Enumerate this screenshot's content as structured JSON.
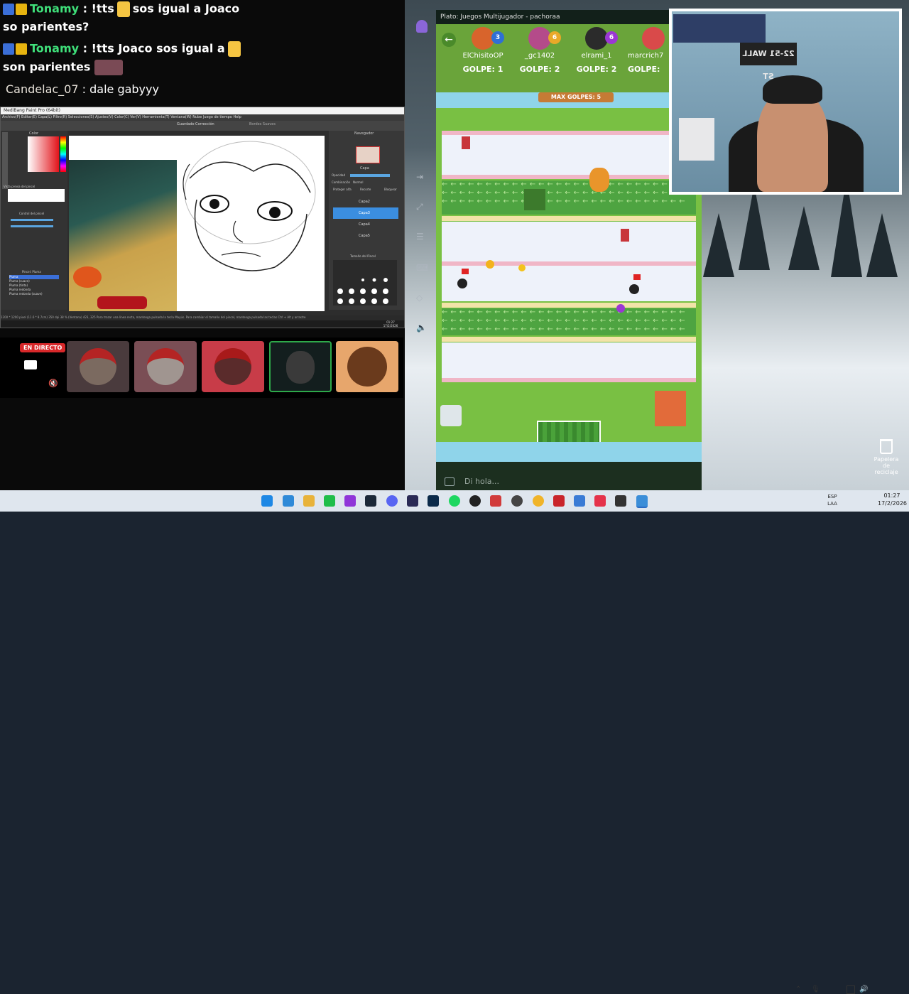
{
  "chat": {
    "messages": [
      {
        "user": "Tonamy",
        "text_before": ": !tts",
        "text_after": "sos igual a Joaco",
        "line2": "so parientes?"
      },
      {
        "user": "Tonamy",
        "text_before": ": !tts Joaco sos igual a",
        "line2": "son parientes"
      },
      {
        "user": "Candelac_07",
        "text": ": dale gabyyy"
      }
    ]
  },
  "paint": {
    "window_title": "MediBang Paint Pro (64bit)",
    "menu": "Archivo(F)   Editar(E)   Capa(L)   Filtro(R)   Selecciones(S)   Ajustes(V)   Color(C)   Ver(V)   Herramienta(T)   Ventana(W)   Nube   Juego de tiempo   Help",
    "saved_label": "Guardado",
    "correction_label": "Corrección",
    "border_label": "Bordes Suaves",
    "panels": {
      "color": "Color",
      "brush_preview": "Vista previa del pincel",
      "brush_control": "Control del pincel",
      "brush": "Pincel: Pluma",
      "navigator": "Navegador",
      "layer": "Capa",
      "opacity": "Opacidad",
      "blend": "Combinación",
      "blend_value": "Normal",
      "protect_alpha": "Proteger alfa",
      "clipping": "Recorte",
      "lock": "Bloquear",
      "brush_size": "Tamaño del Pincel"
    },
    "layers": [
      "Capa2",
      "Capa3",
      "Capa4",
      "Capa5"
    ],
    "brushes": [
      "Pluma",
      "Pluma (suave)",
      "Pluma (tinta)",
      "Pluma redonda",
      "Pluma redonda (suave)"
    ],
    "status": "1200 * 1200 pixel  (11.6 * 8.7cm)  350 dpi  38 %   (Ventana) 423, 325   Para trazar una línea recta, mantenga pulsada la tecla Mayús. Para cambiar el tamaño del pincel, mantenga pulsada las teclas Ctrl + Alt y arrastre",
    "time": "01:27",
    "date": "17/2/2026"
  },
  "call": {
    "live_label": "EN DIRECTO"
  },
  "game": {
    "window_title": "Plato: Juegos Multijugador - pachoraa",
    "max_label": "MAX GOLPES: 5",
    "chat_placeholder": "Di hola...",
    "players": [
      {
        "name": "ElChisitoOP",
        "badge": "3",
        "score": "GOLPE: 1",
        "badge_color": "#2f6fd6",
        "avatar_color": "#d8642c"
      },
      {
        "name": "_gc1402",
        "badge": "6",
        "score": "GOLPE: 2",
        "badge_color": "#e9a928",
        "avatar_color": "#b44b8a"
      },
      {
        "name": "elrami_1",
        "badge": "6",
        "score": "GOLPE: 2",
        "badge_color": "#9b37d4",
        "avatar_color": "#2b2b2b"
      },
      {
        "name": "marcrich7",
        "badge": "",
        "score": "GOLPE:",
        "badge_color": "#e9a928",
        "avatar_color": "#d94a4a"
      }
    ]
  },
  "webcam": {
    "sign": "22-51 WALL ST"
  },
  "taskbar": {
    "lang_line1": "ESP",
    "lang_line2": "LAA",
    "time": "01:27",
    "date": "17/2/2026",
    "recycle_bin": "Papelera de reciclaje"
  },
  "colors": {
    "accent_green": "#3fe07a",
    "live_red": "#d8282a",
    "course_green": "#79c043"
  }
}
